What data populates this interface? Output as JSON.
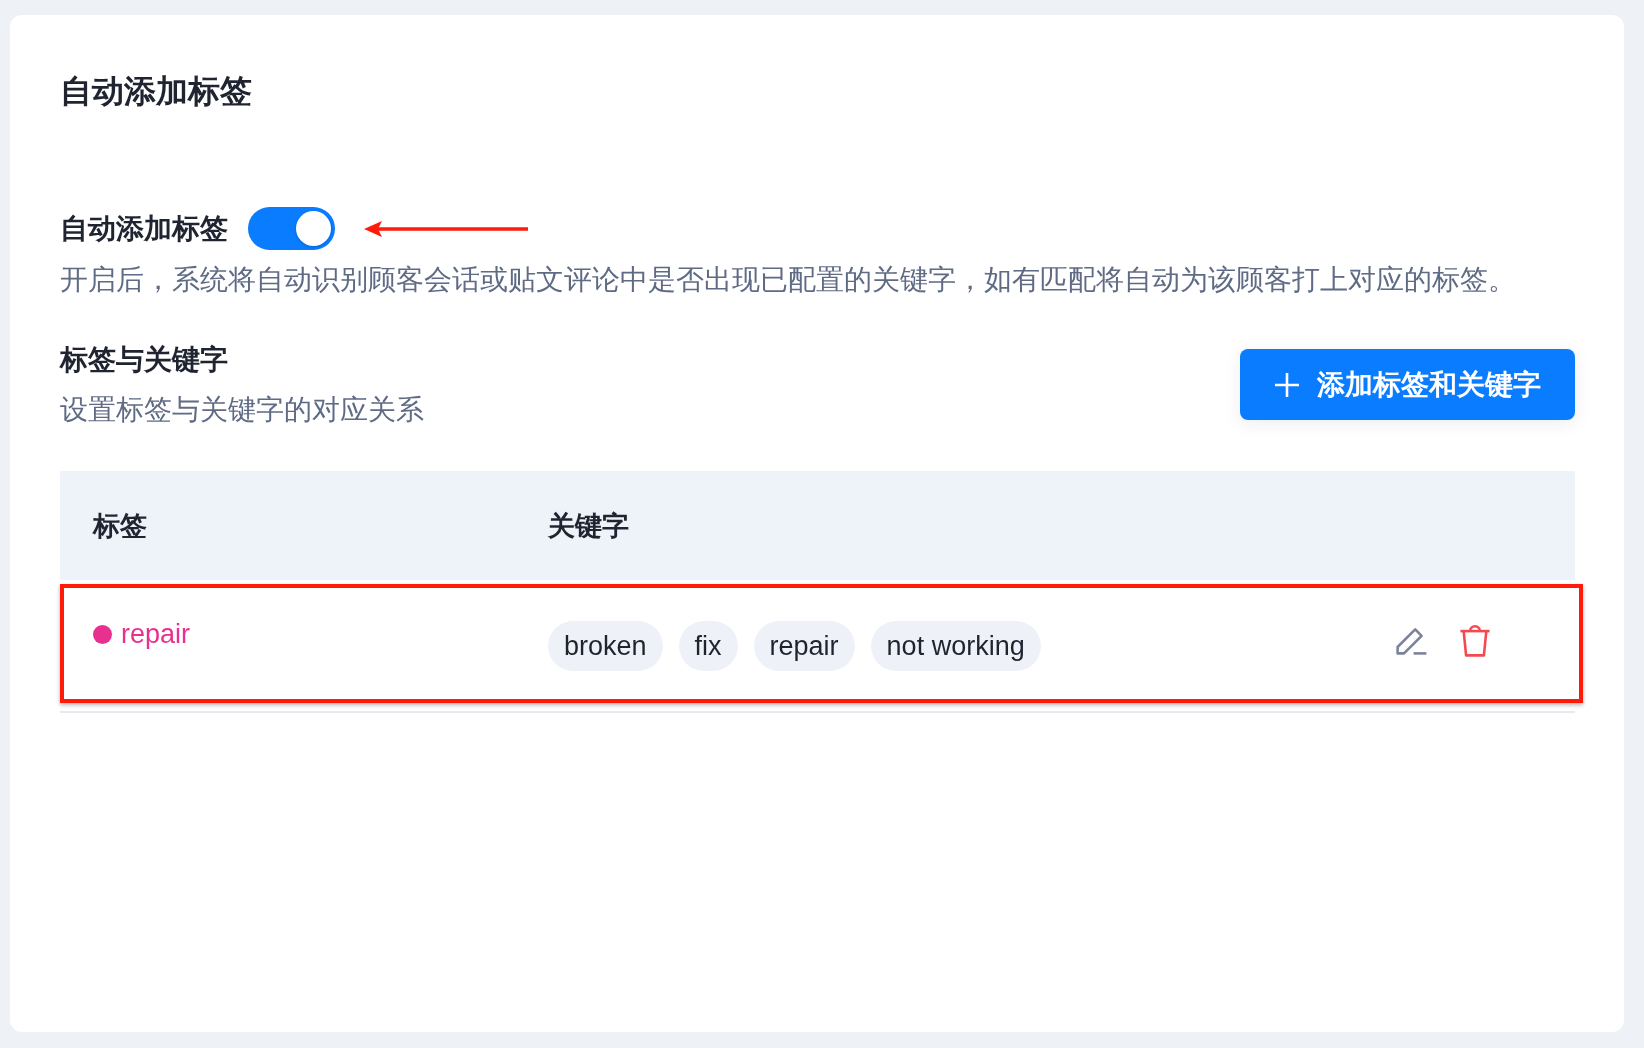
{
  "page": {
    "title": "自动添加标签"
  },
  "auto_tag": {
    "label": "自动添加标签",
    "on": true,
    "description": "开启后，系统将自动识别顾客会话或贴文评论中是否出现已配置的关键字，如有匹配将自动为该顾客打上对应的标签。"
  },
  "mapping": {
    "title": "标签与关键字",
    "subtitle": "设置标签与关键字的对应关系",
    "add_button": {
      "label": "添加标签和关键字"
    }
  },
  "table": {
    "columns": [
      "标签",
      "关键字"
    ],
    "rows": [
      {
        "tag": {
          "name": "repair",
          "color": "#e8318f"
        },
        "keywords": [
          "broken",
          "fix",
          "repair",
          "not working"
        ]
      }
    ]
  }
}
